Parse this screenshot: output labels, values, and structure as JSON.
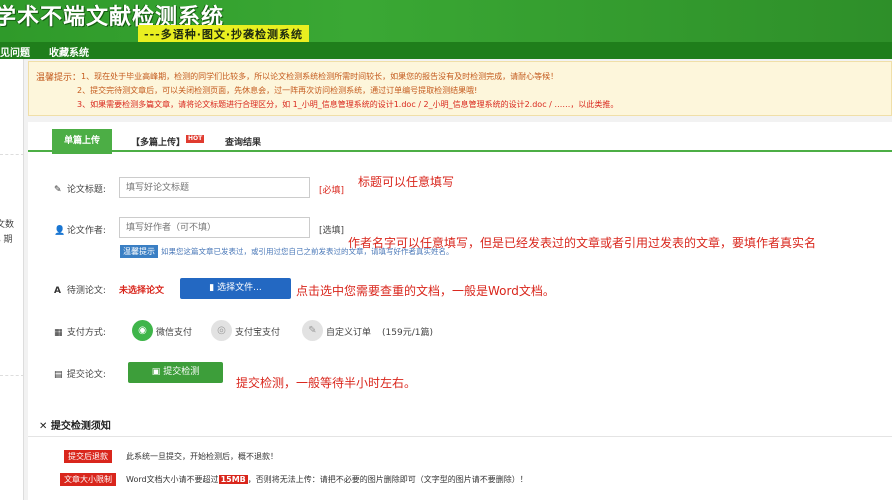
{
  "header": {
    "title": "学术不端文献检测系统",
    "subtitle": "---多语种·图文·抄袭检测系统"
  },
  "nav": {
    "items": [
      "见问题",
      "收藏系统"
    ]
  },
  "sidebar": {
    "text1": "文数",
    "text2": "s 期"
  },
  "notice": {
    "title": "温馨提示：",
    "lines": [
      "1、现在处于毕业高峰期，检测的同学们比较多，所以论文检测系统检测所需时间较长，如果您的报告没有及时检测完成，请耐心等候！",
      "2、提交完待测文章后，可以关闭检测页面，先休息会，过一阵再次访问检测系统，通过订单编号提取检测结果哦!",
      "3、如果需要检测多篇文章，请将论文标题进行合理区分，如 1_小明_信息管理系统的设计1.doc / 2_小明_信息管理系统的设计2.doc / ……，以此类推。"
    ]
  },
  "tabs": {
    "single": "单篇上传",
    "multi": "【多篇上传】",
    "hot": "HOT",
    "query": "查询结果"
  },
  "form": {
    "title_label": "论文标题:",
    "title_placeholder": "填写好论文标题",
    "title_required": "[必填]",
    "author_label": "论文作者:",
    "author_placeholder": "填写好作者（可不填）",
    "author_optional": "[选填]",
    "hint_badge": "温馨提示",
    "hint_text": "如果您这篇文章已发表过，或引用过您自己之前发表过的文章，请填写好作者真实姓名。",
    "file_label": "待测论文:",
    "no_file": "未选择论文",
    "choose_file": "选择文件...",
    "pay_label": "支付方式:",
    "pay_wechat": "微信支付",
    "pay_alipay": "支付宝支付",
    "pay_custom": "自定义订单",
    "pay_price": "(159元/1篇)",
    "submit_label": "提交论文:",
    "submit_button": "提交检测"
  },
  "rules": {
    "title": "提交检测须知",
    "items": [
      {
        "badge": "提交后退款",
        "text": "此系统一旦提交，开始检测后，概不退款！"
      },
      {
        "badge": "文章大小限制",
        "pre": "Word文档大小请不要超过",
        "size": "15MB",
        "post": "，否则将无法上传：请把不必要的图片删除即可（文字型的图片请不要删除）！"
      }
    ]
  },
  "annotations": {
    "a1": "标题可以任意填写",
    "a2": "作者名字可以任意填写，但是已经发表过的文章或者引用过发表的文章，要填作者真实名",
    "a3": "点击选中您需要查重的文档，一般是Word文档。",
    "a4": "提交检测，一般等待半小时左右。"
  },
  "colors": {
    "header_green": "#3aa834",
    "accent_green": "#4cae45",
    "blue_button": "#2368c2",
    "red": "#d9261c"
  }
}
